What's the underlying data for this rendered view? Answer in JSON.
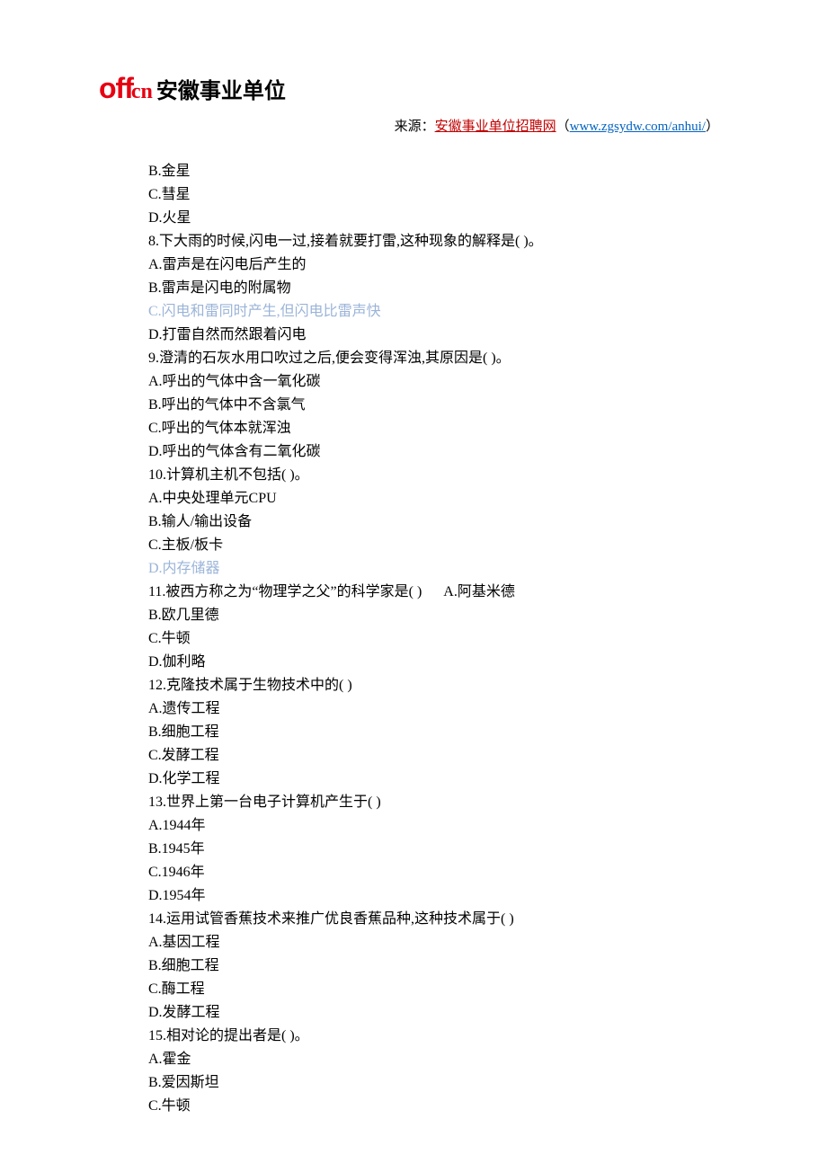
{
  "logo": {
    "off": "off",
    "swoosh": "cn",
    "cn": "安徽事业单位"
  },
  "source": {
    "label": "来源：",
    "red": "安徽事业单位招聘网",
    "open": "（",
    "url": "www.zgsydw.com/anhui/",
    "close": "）"
  },
  "lines": [
    {
      "t": "B.金星",
      "hl": false
    },
    {
      "t": "C.彗星",
      "hl": false
    },
    {
      "t": "D.火星",
      "hl": false
    },
    {
      "t": "8.下大雨的时候,闪电一过,接着就要打雷,这种现象的解释是( )。",
      "hl": false
    },
    {
      "t": "A.雷声是在闪电后产生的",
      "hl": false
    },
    {
      "t": "B.雷声是闪电的附属物",
      "hl": false
    },
    {
      "t": "C.闪电和雷同时产生,但闪电比雷声快",
      "hl": true
    },
    {
      "t": "D.打雷自然而然跟着闪电",
      "hl": false
    },
    {
      "t": "9.澄清的石灰水用口吹过之后,便会变得浑浊,其原因是( )。",
      "hl": false
    },
    {
      "t": "A.呼出的气体中含一氧化碳",
      "hl": false
    },
    {
      "t": "B.呼出的气体中不含氯气",
      "hl": false
    },
    {
      "t": "C.呼出的气体本就浑浊",
      "hl": false
    },
    {
      "t": "D.呼出的气体含有二氧化碳",
      "hl": false
    },
    {
      "t": "10.计算机主机不包括( )。",
      "hl": false
    },
    {
      "t": "A.中央处理单元CPU",
      "hl": false
    },
    {
      "t": "B.输人/输出设备",
      "hl": false
    },
    {
      "t": "C.主板/板卡",
      "hl": false
    },
    {
      "t": "D.内存储器",
      "hl": true
    },
    {
      "t": "11.被西方称之为“物理学之父”的科学家是( )      A.阿基米德",
      "hl": false
    },
    {
      "t": "B.欧几里德",
      "hl": false
    },
    {
      "t": "C.牛顿",
      "hl": false
    },
    {
      "t": "D.伽利略",
      "hl": false
    },
    {
      "t": "12.克隆技术属于生物技术中的( )",
      "hl": false
    },
    {
      "t": "A.遗传工程",
      "hl": false
    },
    {
      "t": "B.细胞工程",
      "hl": false
    },
    {
      "t": "C.发酵工程",
      "hl": false
    },
    {
      "t": "D.化学工程",
      "hl": false
    },
    {
      "t": "13.世界上第一台电子计算机产生于( )",
      "hl": false
    },
    {
      "t": "A.1944年",
      "hl": false
    },
    {
      "t": "B.1945年",
      "hl": false
    },
    {
      "t": "C.1946年",
      "hl": false
    },
    {
      "t": "D.1954年",
      "hl": false
    },
    {
      "t": "14.运用试管香蕉技术来推广优良香蕉品种,这种技术属于( )",
      "hl": false
    },
    {
      "t": "A.基因工程",
      "hl": false
    },
    {
      "t": "B.细胞工程",
      "hl": false
    },
    {
      "t": "C.酶工程",
      "hl": false
    },
    {
      "t": "D.发酵工程",
      "hl": false
    },
    {
      "t": "15.相对论的提出者是( )。",
      "hl": false
    },
    {
      "t": "A.霍金",
      "hl": false
    },
    {
      "t": "B.爱因斯坦",
      "hl": false
    },
    {
      "t": "C.牛顿",
      "hl": false
    }
  ]
}
